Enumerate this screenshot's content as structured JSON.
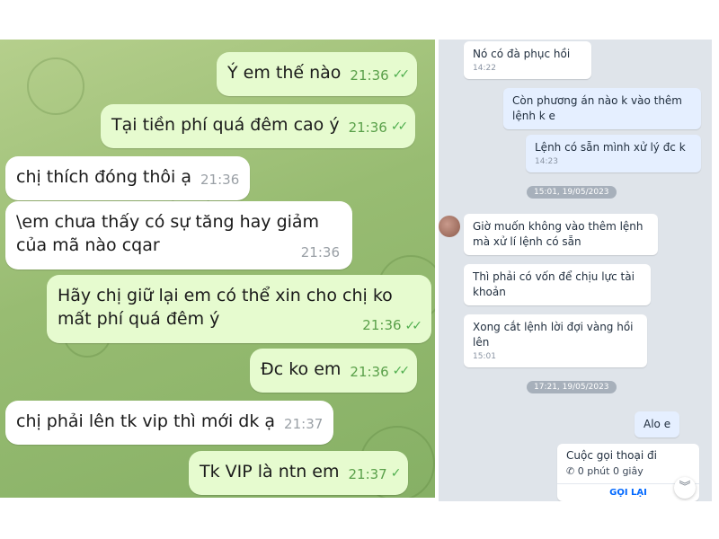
{
  "telegram": {
    "messages": [
      {
        "text": "Ý em thế nào",
        "time": "21:36",
        "dir": "out",
        "ticks": "✓✓"
      },
      {
        "text": "Tại tiền phí quá đêm cao ý",
        "time": "21:36",
        "dir": "out",
        "ticks": "✓✓"
      },
      {
        "text": "chị thích đóng thôi ạ",
        "time": "21:36",
        "dir": "in"
      },
      {
        "lines": [
          "\\em chưa thấy có sự tăng hay giảm",
          "của mã nào cqar"
        ],
        "time": "21:36",
        "dir": "in"
      },
      {
        "lines": [
          "Hãy chị giữ lại em có thể xin cho chị ko",
          "mất phí quá đêm ý"
        ],
        "time": "21:36",
        "dir": "out",
        "ticks": "✓✓"
      },
      {
        "text": "Đc ko em",
        "time": "21:36",
        "dir": "out",
        "ticks": "✓✓"
      },
      {
        "text": "chị phải lên tk vip thì mới dk ạ",
        "time": "21:37",
        "dir": "in"
      },
      {
        "text": "Tk VIP là ntn em",
        "time": "21:37",
        "dir": "out",
        "ticks": "✓"
      }
    ]
  },
  "zalo": {
    "messages": [
      {
        "text": "Nó có đà phục hồi",
        "time": "14:22",
        "dir": "in"
      },
      {
        "lines": [
          "Còn phương án nào k vào thêm",
          "lệnh k e"
        ],
        "dir": "out"
      },
      {
        "text": "Lệnh có sẵn mình xử lý đc k",
        "time": "14:23",
        "dir": "out"
      },
      {
        "separator": "15:01, 19/05/2023"
      },
      {
        "lines": [
          "Giờ muốn không vào thêm lệnh",
          "mà xử lí lệnh có sẵn"
        ],
        "dir": "in"
      },
      {
        "lines": [
          "Thì phải có vốn để chịu lực tài",
          "khoản"
        ],
        "dir": "in"
      },
      {
        "lines": [
          "Xong cắt lệnh lời đợi vàng hồi",
          "lên"
        ],
        "time": "15:01",
        "dir": "in"
      },
      {
        "separator": "17:21, 19/05/2023"
      },
      {
        "text": "Alo e",
        "dir": "out"
      }
    ],
    "call": {
      "title": "Cuộc gọi thoại đi",
      "duration": "0 phút 0 giây",
      "action": "GỌI LẠI"
    },
    "scroll_icon": "chevron-double-down-icon"
  }
}
